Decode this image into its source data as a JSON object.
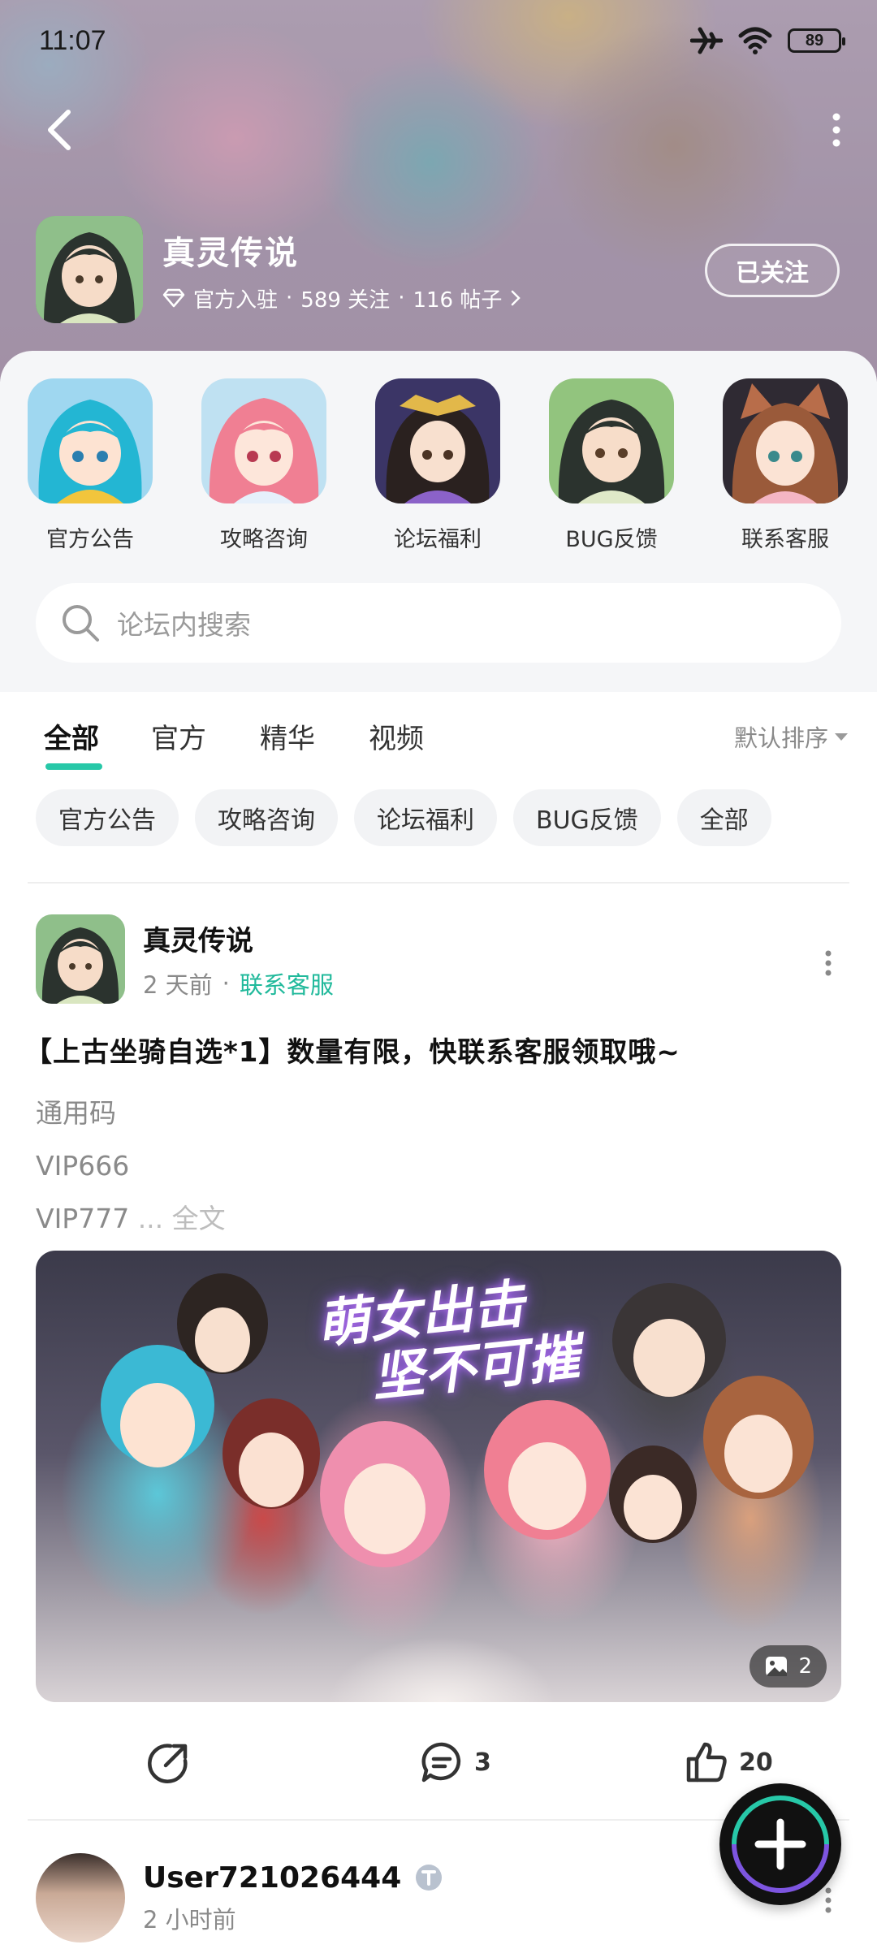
{
  "status_bar": {
    "time": "11:07",
    "battery": "89"
  },
  "forum": {
    "name": "真灵传说",
    "badge_label": "官方入驻",
    "followers": "589 关注",
    "posts": "116 帖子",
    "follow_state": "已关注"
  },
  "categories": [
    {
      "label": "官方公告",
      "icon": "teal-hair-character-icon"
    },
    {
      "label": "攻略咨询",
      "icon": "pink-hair-character-icon"
    },
    {
      "label": "论坛福利",
      "icon": "dark-hair-crowned-character-icon"
    },
    {
      "label": "BUG反馈",
      "icon": "green-robe-character-icon"
    },
    {
      "label": "联系客服",
      "icon": "fox-ear-character-icon"
    }
  ],
  "search": {
    "placeholder": "论坛内搜索"
  },
  "tabs": [
    {
      "label": "全部",
      "active": true
    },
    {
      "label": "官方",
      "active": false
    },
    {
      "label": "精华",
      "active": false
    },
    {
      "label": "视频",
      "active": false
    }
  ],
  "sort": {
    "label": "默认排序"
  },
  "chips": [
    "官方公告",
    "攻略咨询",
    "论坛福利",
    "BUG反馈",
    "全部"
  ],
  "post": {
    "author": "真灵传说",
    "time": "2 天前",
    "category": "联系客服",
    "title": "【上古坐骑自选*1】数量有限，快联系客服领取哦~",
    "body_lines": [
      "通用码",
      "VIP666",
      "VIP777"
    ],
    "ellipsis": " ...",
    "read_more": " 全文",
    "image_headline_1": "萌女出击",
    "image_headline_2": "坚不可摧",
    "image_count": "2",
    "comments": "3",
    "likes": "20"
  },
  "post2": {
    "author": "User721026444",
    "time": "2 小时前"
  },
  "colors": {
    "accent": "#27c8a8",
    "tag_text": "#20b99b",
    "muted": "#8a8a8a"
  }
}
